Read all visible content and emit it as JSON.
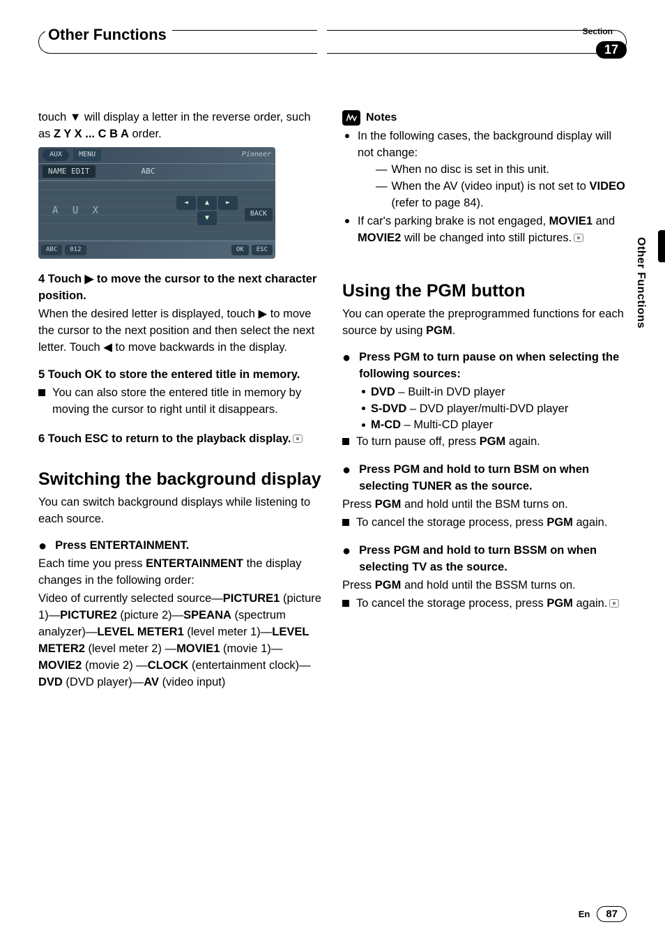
{
  "header": {
    "section_label": "Section",
    "section_number": "17",
    "title": "Other Functions",
    "side_tab": "Other Functions"
  },
  "left": {
    "intro1": "touch ▼ will display a letter in the reverse order, such as ",
    "intro1_bold": "Z Y X ... C B A",
    "intro1_tail": " order.",
    "fig": {
      "menu": "MENU",
      "name_edit": "NAME EDIT",
      "abc_top": "ABC",
      "brand": "Pioneer",
      "aux": "A U X",
      "back": "BACK",
      "abc_small": "ABC",
      "num": "012",
      "ok": "OK",
      "esc": "ESC"
    },
    "step4_head": "4   Touch ▶ to move the cursor to the next character position.",
    "step4_body1": "When the desired letter is displayed, touch ▶ to move the cursor to the next position and then select the next letter. Touch ◀ to move backwards in the display.",
    "step5_head": "5   Touch OK to store the entered title in memory.",
    "step5_body": "You can also store the entered title in memory by moving the cursor to right until it disappears.",
    "step6_head": "6   Touch ESC to return to the playback display.",
    "h2_bg": "Switching the background display",
    "bg_body": "You can switch background displays while listening to each source.",
    "bg_press_head": "Press ENTERTAINMENT.",
    "bg_press_body_1": "Each time you press ",
    "bg_press_body_1b": "ENTERTAINMENT",
    "bg_press_body_1c": " the display changes in the following order:",
    "bg_order_1": "Video of currently selected source—",
    "bg_order_1b": "PICTURE1",
    "bg_order_2a": " (picture 1)—",
    "bg_order_2b": "PICTURE2",
    "bg_order_2c": " (picture 2)—",
    "bg_order_2d": "SPEANA",
    "bg_order_3a": " (spectrum analyzer)—",
    "bg_order_3b": "LEVEL METER1",
    "bg_order_3c": " (level meter 1)—",
    "bg_order_3d": "LEVEL METER2",
    "bg_order_3e": " (level meter 2) —",
    "bg_order_3f": "MOVIE1",
    "bg_order_3g": " (movie 1)—",
    "bg_order_3h": "MOVIE2",
    "bg_order_3i": " (movie 2) —",
    "bg_order_3j": "CLOCK",
    "bg_order_3k": " (entertainment clock)—",
    "bg_order_3l": "DVD",
    "bg_order_3m": " (DVD player)—",
    "bg_order_3n": "AV",
    "bg_order_3o": " (video input)"
  },
  "right": {
    "notes_label": "Notes",
    "note1": "In the following cases, the background display will not change:",
    "note1_sub1": "When no disc is set in this unit.",
    "note1_sub2a": "When the AV (video input) is not set to ",
    "note1_sub2b": "VIDEO",
    "note1_sub2c": " (refer to page 84).",
    "note2a": "If car's parking brake is not engaged, ",
    "note2b": "MOVIE1",
    "note2c": " and ",
    "note2d": "MOVIE2",
    "note2e": " will be changed into still pictures.",
    "h2_pgm": "Using the PGM button",
    "pgm_intro_a": "You can operate the preprogrammed functions for each source by using ",
    "pgm_intro_b": "PGM",
    "pgm_intro_c": ".",
    "pgm_press1_head": "Press PGM to turn pause on when selecting the following sources:",
    "pgm_src": [
      {
        "b": "DVD",
        "t": " – Built-in DVD player"
      },
      {
        "b": "S-DVD",
        "t": " – DVD player/multi-DVD player"
      },
      {
        "b": "M-CD",
        "t": " – Multi-CD player"
      }
    ],
    "pgm_pauseoff_a": "To turn pause off, press ",
    "pgm_pauseoff_b": "PGM",
    "pgm_pauseoff_c": " again.",
    "pgm_press2_head": "Press PGM and hold to turn BSM on when selecting TUNER as the source.",
    "pgm_press2_body_a": "Press ",
    "pgm_press2_body_b": "PGM",
    "pgm_press2_body_c": " and hold until the BSM turns on.",
    "pgm_cancel_a": "To cancel the storage process, press ",
    "pgm_cancel_b": "PGM",
    "pgm_cancel_c": " again.",
    "pgm_press3_head": "Press PGM and hold to turn BSSM on when selecting TV as the source.",
    "pgm_press3_body_a": "Press ",
    "pgm_press3_body_b": "PGM",
    "pgm_press3_body_c": " and hold until the BSSM turns on.",
    "pgm_cancel2_a": "To cancel the storage process, press ",
    "pgm_cancel2_b": "PGM",
    "pgm_cancel2_c": " again."
  },
  "footer": {
    "lang": "En",
    "page": "87"
  }
}
